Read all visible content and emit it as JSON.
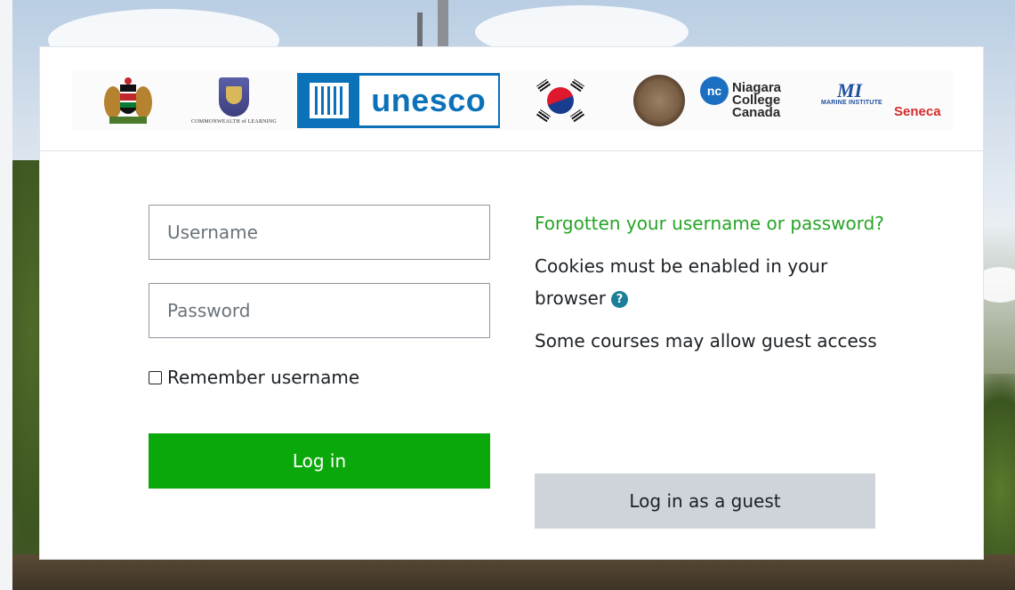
{
  "logos": {
    "col_caption": "COMMONWEALTH of LEARNING",
    "unesco_word": "unesco",
    "nc_badge": "nc",
    "niagara_lines": [
      "Niagara",
      "College",
      "Canada"
    ],
    "mi_mark": "MI",
    "mi_text": "MARINE INSTITUTE",
    "seneca": "Seneca"
  },
  "login": {
    "username_placeholder": "Username",
    "password_placeholder": "Password",
    "remember_label": "Remember username",
    "login_button": "Log in"
  },
  "side": {
    "forgot_link": "Forgotten your username or password?",
    "cookies_text": "Cookies must be enabled in your browser",
    "help_icon": "?",
    "guest_info": "Some courses may allow guest access",
    "guest_button": "Log in as a guest"
  },
  "colors": {
    "login_button": "#0ba80b",
    "forgot_link": "#26a426",
    "guest_button": "#ced4da",
    "help_icon": "#1c7f99",
    "unesco_blue": "#0b72b9"
  }
}
